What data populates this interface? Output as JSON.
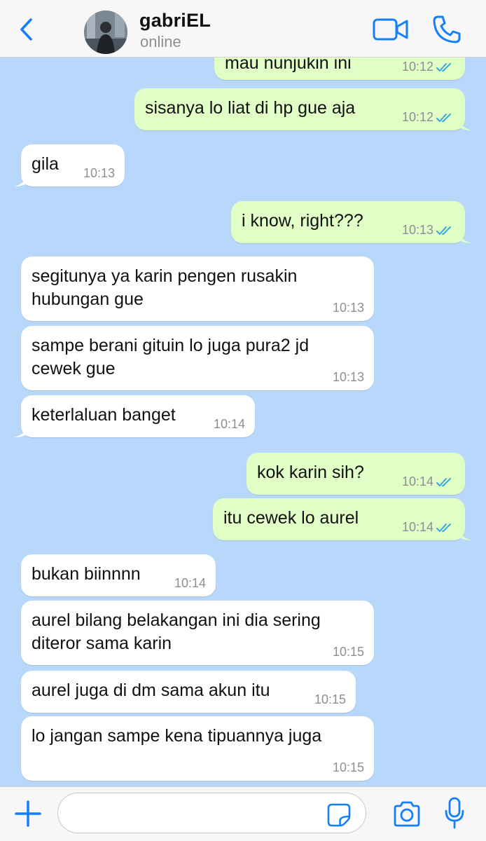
{
  "header": {
    "contact_name": "gabriEL",
    "status": "online",
    "back_icon": "chevron-left-icon",
    "video_icon": "video-camera-icon",
    "call_icon": "phone-icon",
    "accent_color": "#147efb"
  },
  "messages": [
    {
      "direction": "out",
      "text": "mau nunjukin ini",
      "time": "10:12",
      "read": true
    },
    {
      "direction": "out",
      "text": "sisanya lo liat di hp gue aja",
      "time": "10:12",
      "read": true
    },
    {
      "direction": "in",
      "text": "gila",
      "time": "10:13"
    },
    {
      "direction": "out",
      "text": "i know, right???",
      "time": "10:13",
      "read": true
    },
    {
      "direction": "in",
      "text": "segitunya ya karin pengen rusakin\nhubungan gue",
      "time": "10:13"
    },
    {
      "direction": "in",
      "text": "sampe berani gituin lo juga pura2 jd\ncewek gue",
      "time": "10:13"
    },
    {
      "direction": "in",
      "text": "keterlaluan banget",
      "time": "10:14"
    },
    {
      "direction": "out",
      "text": "kok karin sih?",
      "time": "10:14",
      "read": true
    },
    {
      "direction": "out",
      "text": "itu cewek lo aurel",
      "time": "10:14",
      "read": true
    },
    {
      "direction": "in",
      "text": "bukan biinnnn",
      "time": "10:14"
    },
    {
      "direction": "in",
      "text": "aurel bilang belakangan ini dia sering\nditeror sama karin",
      "time": "10:15"
    },
    {
      "direction": "in",
      "text": "aurel juga di dm sama akun itu",
      "time": "10:15"
    },
    {
      "direction": "in",
      "text": "lo jangan sampe kena tipuannya juga",
      "time": "10:15"
    }
  ],
  "input_bar": {
    "value": "",
    "placeholder": "",
    "plus_icon": "plus-icon",
    "sticker_icon": "sticker-icon",
    "camera_icon": "camera-icon",
    "mic_icon": "microphone-icon"
  },
  "colors": {
    "chat_background": "#b8d8fb",
    "outgoing_bubble": "#e1fec6",
    "incoming_bubble": "#ffffff",
    "read_tick": "#34aadc"
  }
}
